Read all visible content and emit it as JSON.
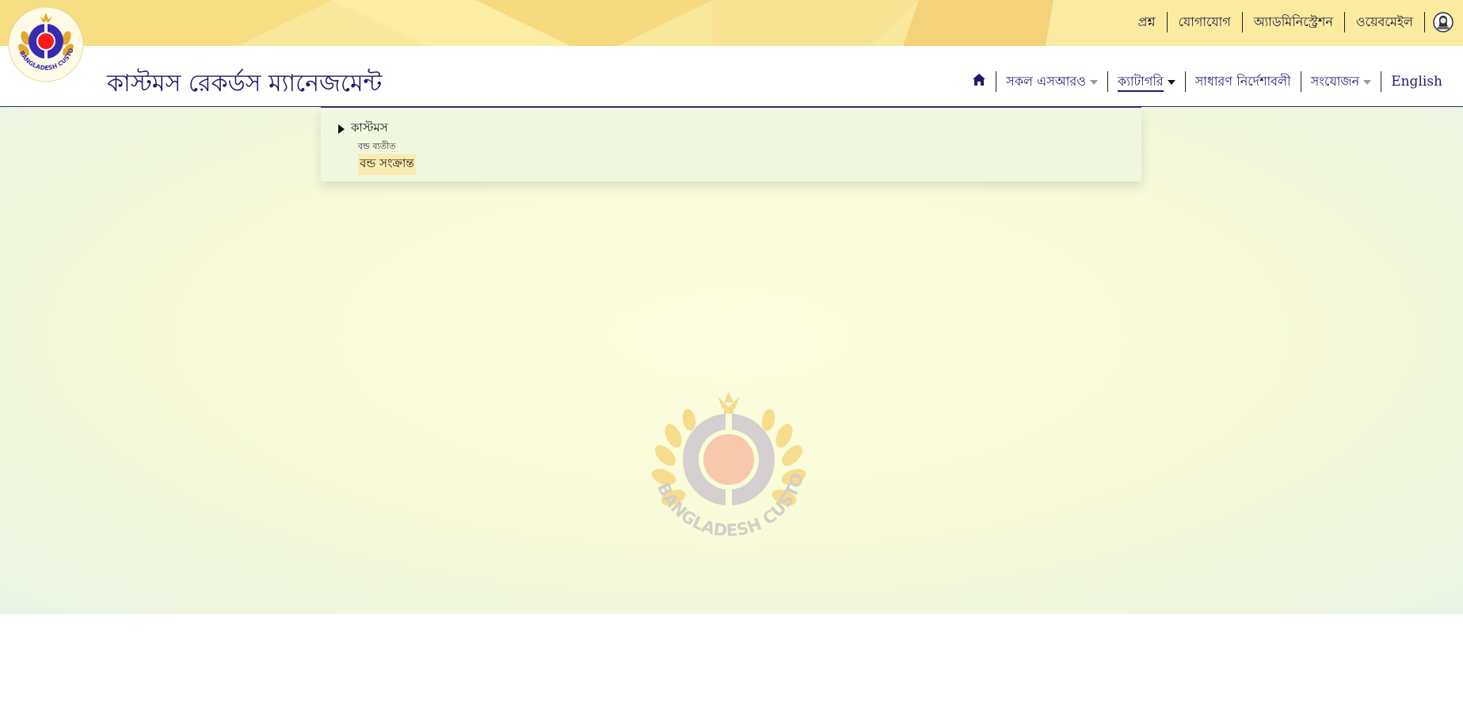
{
  "top_links": [
    {
      "label": "প্রশ্ন"
    },
    {
      "label": "যোগাযোগ"
    },
    {
      "label": "অ্যাডমিনিস্ট্রেশন"
    },
    {
      "label": "ওয়েবমেইল"
    }
  ],
  "header": {
    "site_title": "কাস্টমস রেকর্ডস ম্যানেজমেন্ট",
    "logo_text": "BANGLADESH CUSTOMS & VAT"
  },
  "nav": {
    "items": [
      {
        "label": "সকল এসআরও",
        "has_caret": true
      },
      {
        "label": "ক্যাটাগরি",
        "has_caret": true,
        "active": true
      },
      {
        "label": "সাধারণ নির্দেশাবলী",
        "has_caret": false
      },
      {
        "label": "সংযোজন",
        "has_caret": true
      },
      {
        "label": "English",
        "has_caret": false
      }
    ]
  },
  "category_dropdown": {
    "root_label": "কাস্টমস",
    "children": [
      {
        "label": "বন্ড ব্যতীত"
      },
      {
        "label": "বন্ড সংক্রান্ত",
        "highlighted": true
      }
    ]
  },
  "watermark": {
    "text": "BANGLADESH CUSTOMS & VAT"
  },
  "icons": {
    "home": "home-icon",
    "profile": "user-profile-icon",
    "root_toggle": "triangle-right-icon"
  },
  "colors": {
    "brand_navy": "#1e1a6a",
    "top_strip": "#f8e89c",
    "highlight": "#f8ecb0"
  }
}
